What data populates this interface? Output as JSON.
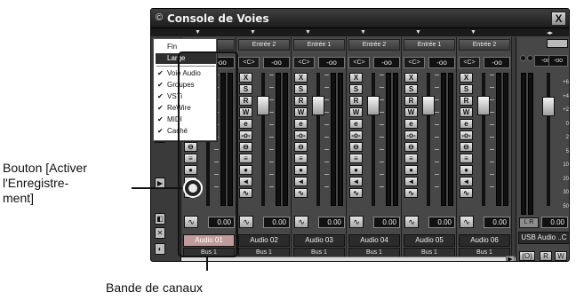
{
  "window": {
    "title": "Console de Voies",
    "title_icon": "©",
    "close_label": "X"
  },
  "channels": [
    {
      "input": "Entrée 2",
      "pan": "<C>",
      "volume": "-oo",
      "volume_bottom": "0.00",
      "name": "Audio 01",
      "bus": "Bus 1",
      "selected": true,
      "input_short": "t.. 2"
    },
    {
      "input": "Entrée 2",
      "pan": "<C>",
      "volume": "-oo",
      "volume_bottom": "0.00",
      "name": "Audio 02",
      "bus": "Bus 1"
    },
    {
      "input": "Entrée 1",
      "pan": "<C>",
      "volume": "-oo",
      "volume_bottom": "0.00",
      "name": "Audio 03",
      "bus": "Bus 1"
    },
    {
      "input": "Entrée 2",
      "pan": "<C>",
      "volume": "-oo",
      "volume_bottom": "0.00",
      "name": "Audio 04",
      "bus": "Bus 1"
    },
    {
      "input": "Entrée 1",
      "pan": "<C>",
      "volume": "-oo",
      "volume_bottom": "0.00",
      "name": "Audio 05",
      "bus": "Bus 1"
    },
    {
      "input": "Entrée 2",
      "pan": "<C>",
      "volume": "-oo",
      "volume_bottom": "0.00",
      "name": "Audio 06",
      "bus": "Bus 1"
    }
  ],
  "channel_buttons": [
    "X",
    "S",
    "R",
    "W",
    "e",
    "-o-",
    "⊖",
    "≡",
    "●",
    "◄",
    "∿"
  ],
  "master": {
    "left_value": "-oo",
    "right_value": "-oo",
    "scale": [
      "+6",
      "+4",
      "+2",
      "0",
      "2",
      "5",
      "10",
      "20",
      "30",
      "50",
      "oo"
    ],
    "lr": "L R",
    "volume": "0.00",
    "name": "USB Audio ..C",
    "btn_a": "(O)",
    "btn_r": "R",
    "btn_w": "W"
  },
  "menu": {
    "items": [
      {
        "label": "Fin",
        "checked": false
      },
      {
        "label": "Large",
        "checked": false,
        "selected": true
      },
      {
        "label": "Voie Audio",
        "checked": true
      },
      {
        "label": "Groupes",
        "checked": true
      },
      {
        "label": "VSTi",
        "checked": true
      },
      {
        "label": "ReWire",
        "checked": true
      },
      {
        "label": "MIDI",
        "checked": true
      },
      {
        "label": "Caché",
        "checked": true
      }
    ],
    "check_mark": "✔"
  },
  "annotations": {
    "record_label": "Bouton [Activer\nl'Enregistre-\nment]",
    "channel_label": "Bande de canaux"
  }
}
